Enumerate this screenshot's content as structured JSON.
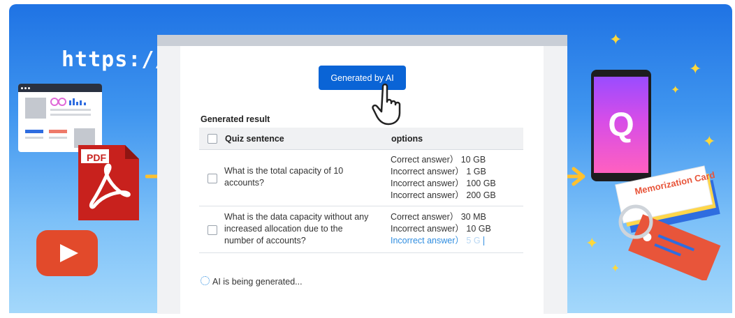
{
  "banner": {
    "url_text": "https://",
    "pdf_label": "PDF",
    "memorization_card_text": "Memorization Card",
    "phone_letter": "Q"
  },
  "quiz": {
    "generate_button_label": "Generated by AI",
    "section_title": "Generated result",
    "columns": [
      "Quiz sentence",
      "options"
    ],
    "rows": [
      {
        "question": "What is the total capacity of 10 accounts?",
        "options": [
          "Correct answer） 10 GB",
          "Incorrect answer） 1 GB",
          "Incorrect answer） 100 GB",
          "Incorrect answer） 200 GB"
        ]
      },
      {
        "question": "What is the data capacity without any increased allocation due to the number of accounts?",
        "options": [
          "Correct answer） 30 MB",
          "Incorrect answer） 10 GB"
        ],
        "streaming_option_prefix": "Incorrect answer）",
        "streaming_option_tail": "5 G"
      }
    ],
    "status_text": "AI is being generated..."
  },
  "colors": {
    "accent_blue": "#0a64d6",
    "arrow_yellow": "#ffc12e",
    "pdf_red": "#c8211d",
    "youtube_red": "#e24a2b"
  },
  "icons": [
    "browser-page-icon",
    "pdf-icon",
    "youtube-play-icon",
    "pointer-hand-icon",
    "loading-spinner-icon",
    "sparkle-icon",
    "smartphone-icon",
    "memorization-card-icon"
  ]
}
